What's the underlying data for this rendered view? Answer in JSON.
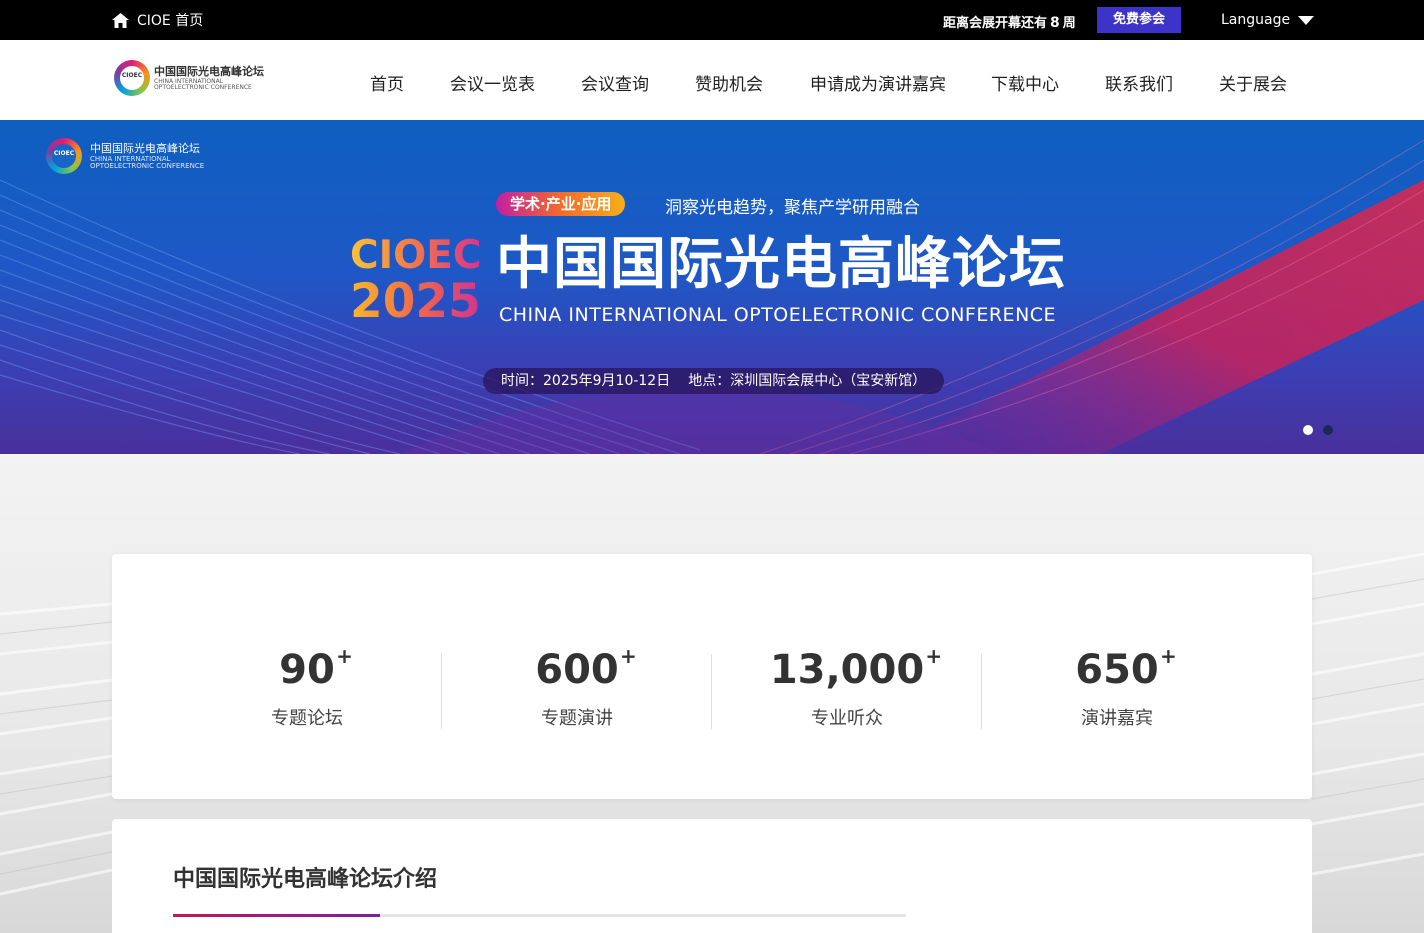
{
  "topbar": {
    "home_label": "CIOE 首页",
    "countdown_prefix": "距离会展开幕还有",
    "countdown_value": "8",
    "countdown_unit": "周",
    "register_label": "免费参会",
    "language_label": "Language"
  },
  "header": {
    "logo": {
      "badge": "CIOEC",
      "cn": "中国国际光电高峰论坛",
      "en": "CHINA INTERNATIONAL OPTOELECTRONIC CONFERENCE"
    },
    "nav": [
      "首页",
      "会议一览表",
      "会议查询",
      "赞助机会",
      "申请成为演讲嘉宾",
      "下载中心",
      "联系我们",
      "关于展会"
    ]
  },
  "banner": {
    "logo": {
      "badge": "CIOEC",
      "cn": "中国国际光电高峰论坛",
      "en": "CHINA INTERNATIONAL OPTOELECTRONIC CONFERENCE"
    },
    "pill": "学术·产业·应用",
    "slogan": "洞察光电趋势，聚焦产学研用融合",
    "brand": "CIOEC",
    "year": "2025",
    "title": "中国国际光电高峰论坛",
    "subtitle": "CHINA INTERNATIONAL OPTOELECTRONIC CONFERENCE",
    "time": "时间：2025年9月10-12日",
    "venue": "地点：深圳国际会展中心（宝安新馆）",
    "slides_total": 2,
    "slide_active": 1
  },
  "stats": [
    {
      "value": "90",
      "suffix": "+",
      "label": "专题论坛"
    },
    {
      "value": "600",
      "suffix": "+",
      "label": "专题演讲"
    },
    {
      "value": "13,000",
      "suffix": "+",
      "label": "专业听众"
    },
    {
      "value": "650",
      "suffix": "+",
      "label": "演讲嘉宾"
    }
  ],
  "intro": {
    "title": "中国国际光电高峰论坛介绍"
  },
  "colors": {
    "accent": "#3d33c8",
    "bar": "#000000",
    "underline": "#c2185b"
  }
}
